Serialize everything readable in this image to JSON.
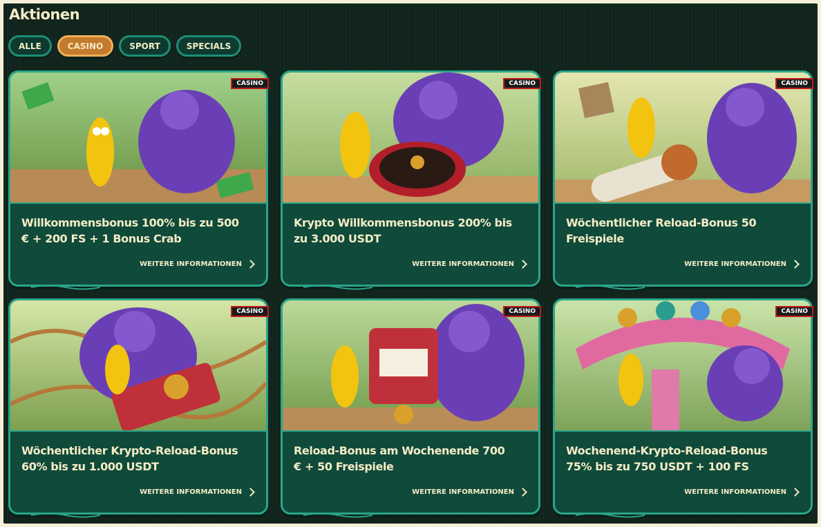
{
  "page": {
    "title": "Aktionen"
  },
  "filters": [
    {
      "label": "Alle",
      "active": false
    },
    {
      "label": "Casino",
      "active": true
    },
    {
      "label": "Sport",
      "active": false
    },
    {
      "label": "Specials",
      "active": false
    }
  ],
  "cards": [
    {
      "badge": "Casino",
      "title": "Willkommensbonus 100% bis zu 500 € + 200 FS + 1 Bonus Crab",
      "link": "Weitere Informationen",
      "image": "banana-gorilla-money-illustration"
    },
    {
      "badge": "Casino",
      "title": "Krypto Willkommensbonus 200% bis zu 3.000 USDT",
      "link": "Weitere Informationen",
      "image": "banana-gorilla-roulette-illustration"
    },
    {
      "badge": "Casino",
      "title": "Wöchentlicher Reload-Bonus 50 Freispiele",
      "link": "Weitere Informationen",
      "image": "banana-gorilla-slot-reel-illustration"
    },
    {
      "badge": "Casino",
      "title": "Wöchentlicher Krypto-Reload-Bonus 60% bis zu 1.000 USDT",
      "link": "Weitere Informationen",
      "image": "banana-gorilla-rollercoaster-illustration"
    },
    {
      "badge": "Casino",
      "title": "Reload-Bonus am Wochenende 700 € + 50 Freispiele",
      "link": "Weitere Informationen",
      "image": "banana-gorilla-slot-machine-illustration"
    },
    {
      "badge": "Casino",
      "title": "Wochenend-Krypto-Reload-Bonus 75% bis zu 750 USDT + 100 FS",
      "link": "Weitere Informationen",
      "image": "banana-gorilla-carousel-illustration"
    }
  ],
  "colors": {
    "background": "#10241c",
    "card": "#0f4a3a",
    "accent": "#2ba58a",
    "active": "#c47a2c",
    "text": "#f4ecc6",
    "badge_border": "#c21d1d"
  }
}
